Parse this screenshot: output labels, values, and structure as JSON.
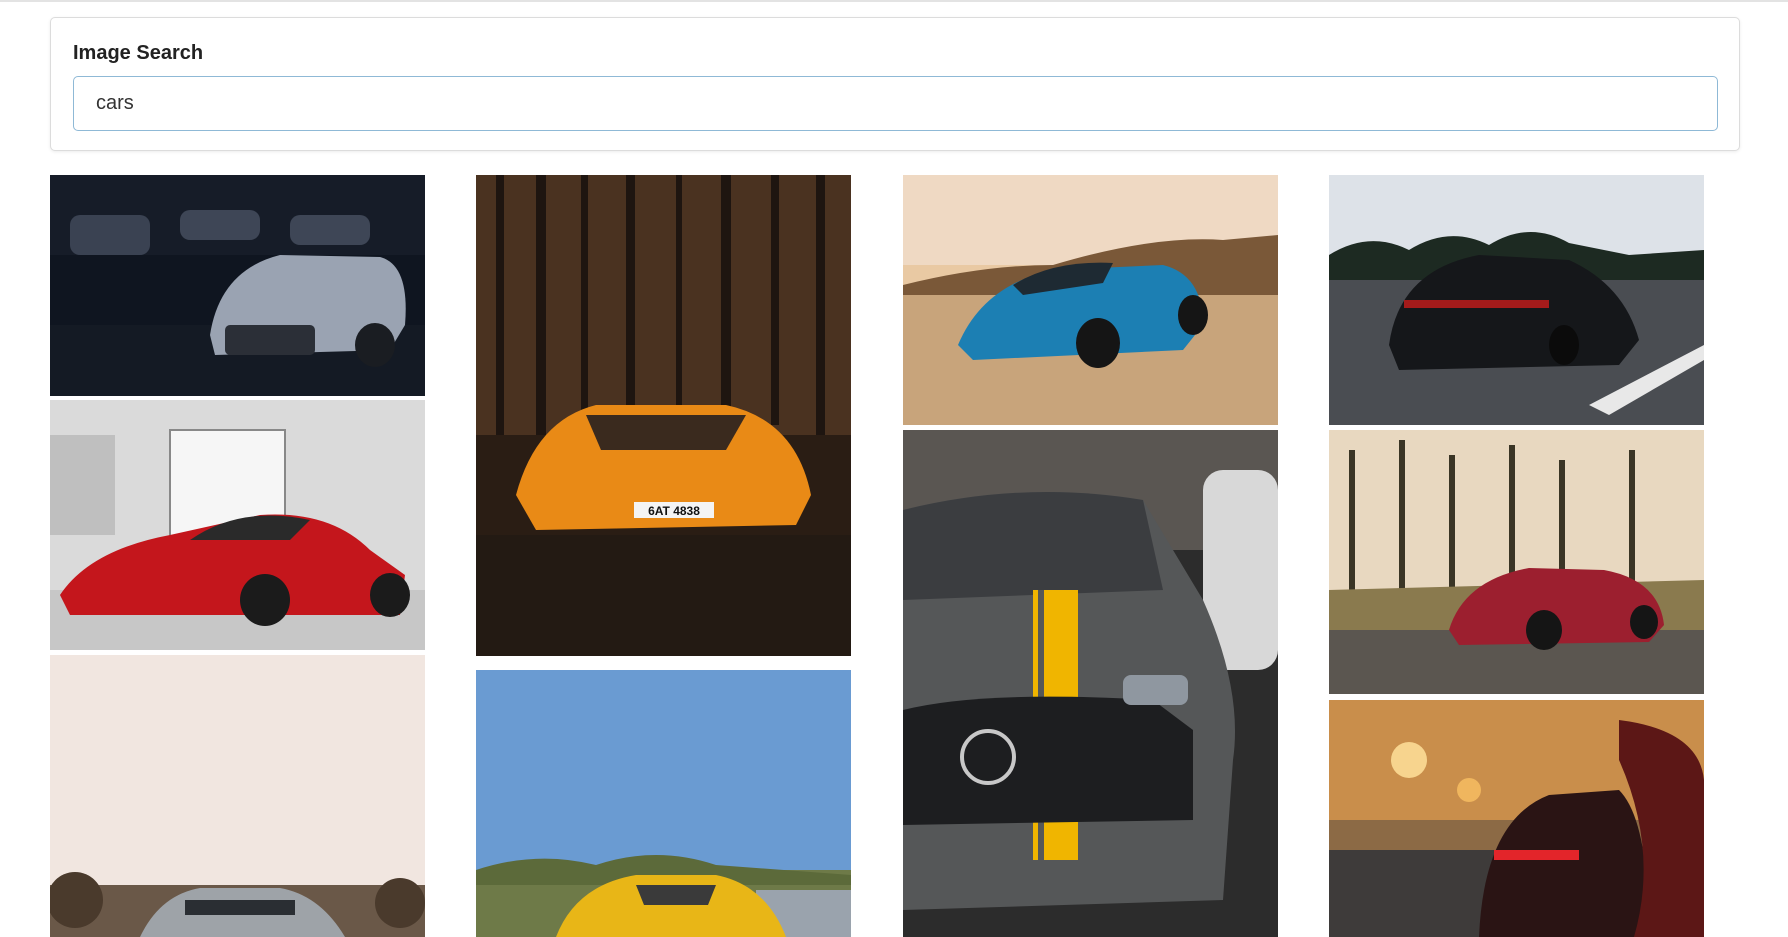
{
  "search": {
    "label": "Image Search",
    "value": "cars"
  },
  "results": [
    {
      "name": "result-image-1",
      "subject": "white sports car in dark garage"
    },
    {
      "name": "result-image-2",
      "subject": "red sports car in showroom"
    },
    {
      "name": "result-image-3",
      "subject": "silver car under pale sky"
    },
    {
      "name": "result-image-4",
      "subject": "orange supercar in dark forest",
      "plate_text": "6AT 4838"
    },
    {
      "name": "result-image-5",
      "subject": "yellow sports car under blue sky"
    },
    {
      "name": "result-image-6",
      "subject": "blue muscle car on dirt road at sunset"
    },
    {
      "name": "result-image-7",
      "subject": "grey sedan with yellow stripe"
    },
    {
      "name": "result-image-8",
      "subject": "black sedan on highway"
    },
    {
      "name": "result-image-9",
      "subject": "red coupe among pine trees"
    },
    {
      "name": "result-image-10",
      "subject": "red car on city street at dusk"
    }
  ]
}
